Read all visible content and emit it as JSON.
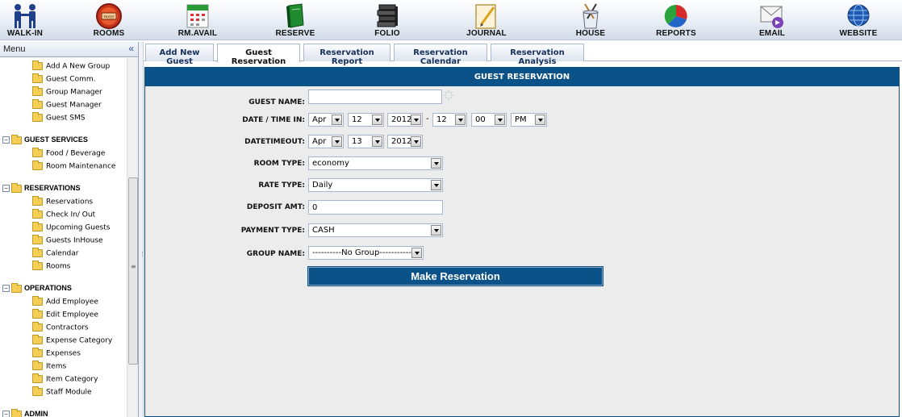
{
  "toolbar": {
    "items": [
      {
        "label": "WALK-IN",
        "icon": "walk-in-icon"
      },
      {
        "label": "ROOMS",
        "icon": "rooms-icon"
      },
      {
        "label": "RM.AVAIL",
        "icon": "calendar-icon"
      },
      {
        "label": "RESERVE",
        "icon": "book-icon"
      },
      {
        "label": "FOLIO",
        "icon": "folio-icon"
      },
      {
        "label": "JOURNAL",
        "icon": "journal-icon"
      },
      {
        "label": "HOUSE",
        "icon": "housekeeping-icon"
      },
      {
        "label": "REPORTS",
        "icon": "reports-icon"
      },
      {
        "label": "EMAIL",
        "icon": "email-icon"
      },
      {
        "label": "WEBSITE",
        "icon": "globe-icon"
      }
    ],
    "rooms_badge": "Hotel"
  },
  "menu": {
    "title": "Menu",
    "collapse_glyph": "«",
    "groups": [
      {
        "label": "",
        "items": [
          "Add A New Group",
          "Guest Comm.",
          "Group Manager",
          "Guest Manager",
          "Guest SMS"
        ]
      },
      {
        "label": "GUEST SERVICES",
        "items": [
          "Food / Beverage",
          "Room Maintenance"
        ]
      },
      {
        "label": "RESERVATIONS",
        "items": [
          "Reservations",
          "Check In/ Out",
          "Upcoming Guests",
          "Guests InHouse",
          "Calendar",
          "Rooms"
        ]
      },
      {
        "label": "OPERATIONS",
        "items": [
          "Add Employee",
          "Edit Employee",
          "Contractors",
          "Expense Category",
          "Expenses",
          "Items",
          "Item Category",
          "Staff Module"
        ]
      },
      {
        "label": "ADMIN",
        "items": []
      }
    ]
  },
  "tabs": [
    {
      "label": "Add New Guest",
      "active": false
    },
    {
      "label": "Guest Reservation",
      "active": true
    },
    {
      "label": "Reservation Report",
      "active": false
    },
    {
      "label": "Reservation Calendar",
      "active": false
    },
    {
      "label": "Reservation Analysis",
      "active": false
    }
  ],
  "form": {
    "title": "GUEST RESERVATION",
    "guest_name": {
      "label": "GUEST NAME:",
      "value": ""
    },
    "date_time_in": {
      "label": "DATE / TIME IN:",
      "month": "Apr",
      "day": "12",
      "year": "2012",
      "separator": "-",
      "hour": "12",
      "minute": "00",
      "ampm": "PM"
    },
    "date_time_out": {
      "label": "DATETIMEOUT:",
      "month": "Apr",
      "day": "13",
      "year": "2012"
    },
    "room_type": {
      "label": "ROOM TYPE:",
      "value": "economy"
    },
    "rate_type": {
      "label": "RATE TYPE:",
      "value": "Daily"
    },
    "deposit_amt": {
      "label": "DEPOSIT AMT:",
      "value": "0"
    },
    "payment_type": {
      "label": "PAYMENT TYPE:",
      "value": "CASH"
    },
    "group_name": {
      "label": "GROUP NAME:",
      "value": "----------No Group------------"
    },
    "submit_label": "Make Reservation"
  },
  "colors": {
    "header_blue": "#0b5288",
    "panel_bg": "#ececec",
    "folder": "#f5cf55"
  }
}
